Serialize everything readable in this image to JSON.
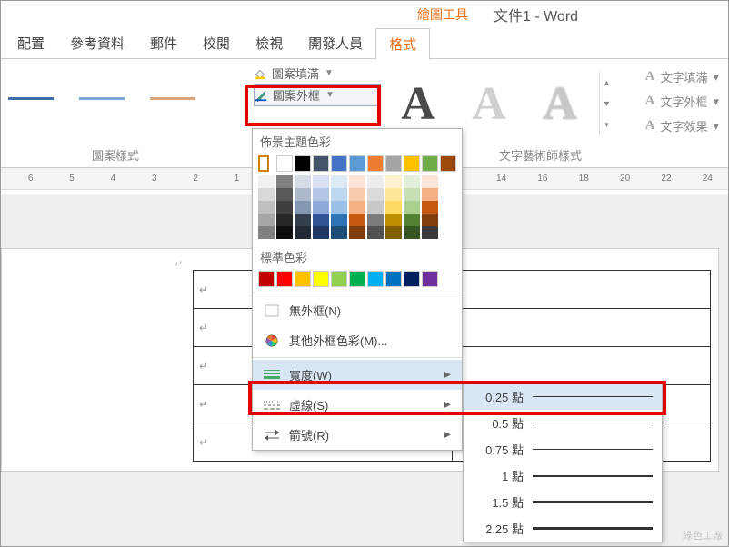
{
  "titlebar": {
    "tools": "繪圖工具",
    "doc": "文件1 - Word"
  },
  "tabs": {
    "t0": "配置",
    "t1": "參考資料",
    "t2": "郵件",
    "t3": "校閱",
    "t4": "檢視",
    "t5": "開發人員",
    "t6": "格式"
  },
  "outline": {
    "fill": "圖案填滿",
    "outline": "圖案外框"
  },
  "textfx": {
    "fill": "文字填滿",
    "outline": "文字外框",
    "effects": "文字效果"
  },
  "groups": {
    "styles": "圖案樣式",
    "wordart": "文字藝術師樣式"
  },
  "ruler": {
    "m6": "6",
    "m5": "5",
    "m4": "4",
    "m3": "3",
    "m2": "2",
    "m1": "1",
    "p14": "14",
    "p16": "16",
    "p18": "18",
    "p20": "20",
    "p22": "22",
    "p24": "24"
  },
  "dropdown": {
    "theme_title": "佈景主題色彩",
    "std_title": "標準色彩",
    "no_outline": "無外框(N)",
    "more_colors": "其他外框色彩(M)...",
    "width": "寬度(W)",
    "dashes": "虛線(S)",
    "arrows": "箭號(R)",
    "theme_colors": [
      "#ffffff",
      "#000000",
      "#44546a",
      "#4472c4",
      "#5b9bd5",
      "#ed7d31",
      "#a5a5a5",
      "#ffc000",
      "#70ad47",
      "#9e480e"
    ],
    "shade_rows": [
      [
        "#f2f2f2",
        "#808080",
        "#d6dce5",
        "#d9e1f2",
        "#deebf7",
        "#fce4d6",
        "#ededed",
        "#fff2cc",
        "#e2efda",
        "#fbe5d6"
      ],
      [
        "#d9d9d9",
        "#595959",
        "#acb9ca",
        "#b4c6e7",
        "#bdd7ee",
        "#f8cbad",
        "#dbdbdb",
        "#ffe699",
        "#c6e0b4",
        "#f4b084"
      ],
      [
        "#bfbfbf",
        "#404040",
        "#8497b0",
        "#8ea9db",
        "#9bc2e6",
        "#f4b084",
        "#c9c9c9",
        "#ffd966",
        "#a9d08e",
        "#c65911"
      ],
      [
        "#a6a6a6",
        "#262626",
        "#333f4f",
        "#305496",
        "#2f75b5",
        "#c65911",
        "#7b7b7b",
        "#bf8f00",
        "#548235",
        "#833c0c"
      ],
      [
        "#808080",
        "#0d0d0d",
        "#222b35",
        "#203764",
        "#1f4e78",
        "#833c0c",
        "#525252",
        "#806000",
        "#375623",
        "#3a3a3a"
      ]
    ],
    "std_colors": [
      "#c00000",
      "#ff0000",
      "#ffc000",
      "#ffff00",
      "#92d050",
      "#00b050",
      "#00b0f0",
      "#0070c0",
      "#002060",
      "#7030a0"
    ]
  },
  "widths": {
    "w0": "0.25 點",
    "w1": "0.5 點",
    "w2": "0.75 點",
    "w3": "1 點",
    "w4": "1.5 點",
    "w5": "2.25 點"
  },
  "watermark": "綠色工廠"
}
